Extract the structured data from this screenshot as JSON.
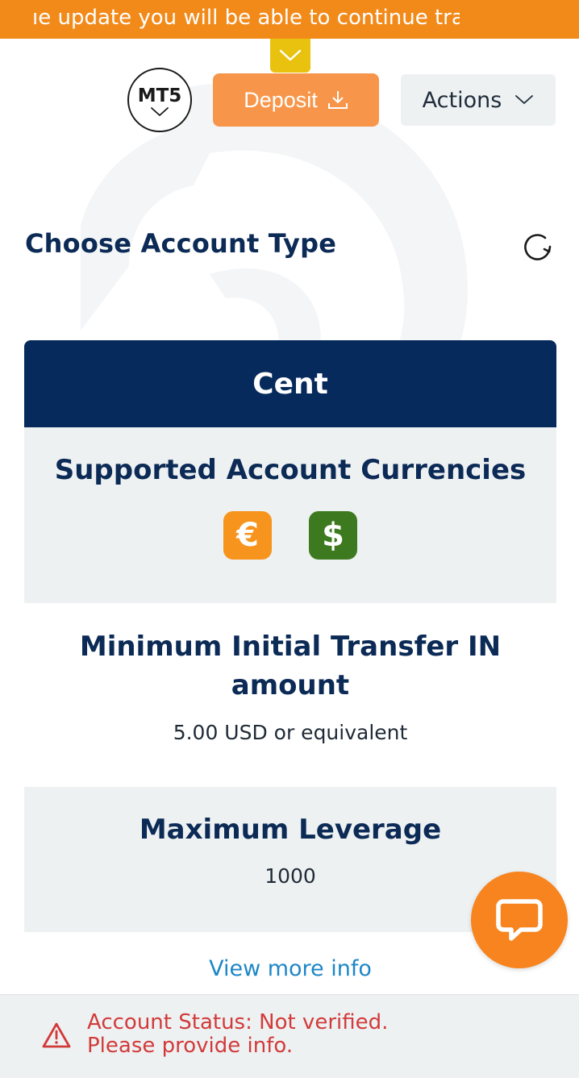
{
  "banner": {
    "text": "ıe update you will be able to continue trac",
    "collapse_icon": "chevron-down-icon"
  },
  "header": {
    "platform_label": "MT5",
    "deposit_label": "Deposit",
    "deposit_icon": "download-icon",
    "actions_label": "Actions",
    "actions_icon": "chevron-down-icon"
  },
  "section": {
    "title": "Choose Account Type",
    "refresh_icon": "refresh-icon"
  },
  "card": {
    "name": "Cent",
    "currencies_heading": "Supported Account Currencies",
    "currencies": [
      {
        "symbol": "€",
        "color": "#f7941d",
        "icon": "euro-icon"
      },
      {
        "symbol": "$",
        "color": "#3d7a1f",
        "icon": "dollar-icon"
      }
    ],
    "transfer_heading": "Minimum Initial Transfer IN amount",
    "transfer_value": "5.00 USD or equivalent",
    "leverage_heading": "Maximum Leverage",
    "leverage_value": "1000",
    "more_link": "View more info"
  },
  "chat": {
    "icon": "chat-bubble-icon"
  },
  "status": {
    "line1": "Account Status: Not verified.",
    "line2": "Please provide info.",
    "icon": "warning-icon"
  },
  "colors": {
    "banner": "#f28a1a",
    "collapse_tab": "#e8c20e",
    "deposit": "#f7964a",
    "card_header": "#062a5c",
    "heading_text": "#0b2a55",
    "link": "#1e86c6",
    "status_text": "#d23a3a",
    "chat": "#f7841e"
  }
}
